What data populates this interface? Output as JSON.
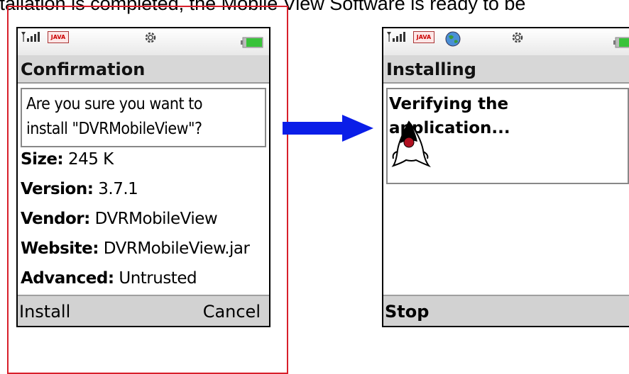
{
  "caption": "stallation is completed, the Mobile View Software is ready to be",
  "left_screen": {
    "status": {
      "java_label": "JAVA"
    },
    "title": "Confirmation",
    "prompt_line1": "Are you sure you want to",
    "prompt_line2": "install \"DVRMobileView\"?",
    "details": [
      {
        "label": "Size:",
        "value": "245 K"
      },
      {
        "label": "Version:",
        "value": "3.7.1"
      },
      {
        "label": "Vendor:",
        "value": "DVRMobileView"
      },
      {
        "label": "Website:",
        "value": "DVRMobileView.jar"
      },
      {
        "label": "Advanced:",
        "value": "Untrusted"
      }
    ],
    "soft_left": "Install",
    "soft_right": "Cancel"
  },
  "right_screen": {
    "status": {
      "java_label": "JAVA"
    },
    "title": "Installing",
    "message": "Verifying the application...",
    "soft_left": "Stop"
  },
  "colors": {
    "frame_red": "#d81f2a",
    "arrow_blue": "#0a1ee8",
    "title_bar_gray": "#d7d7d7",
    "battery_green": "#39c33a"
  },
  "icons": [
    "signal-icon",
    "java-icon",
    "globe-icon",
    "gear-icon",
    "battery-icon",
    "java-duke-icon",
    "arrow-right-icon"
  ]
}
